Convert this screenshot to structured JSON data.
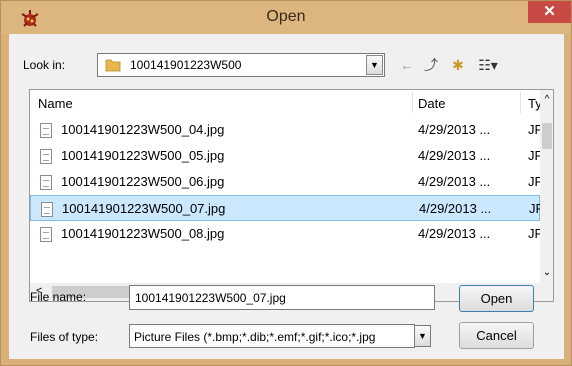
{
  "window": {
    "title": "Open",
    "close_glyph": "✕"
  },
  "look_in": {
    "label": "Look in:",
    "folder": "100141901223W500"
  },
  "toolbar": {
    "back_glyph": "←",
    "up_glyph": "⤴",
    "new_folder_glyph": "✱",
    "views_glyph": "☷▾"
  },
  "file_list": {
    "columns": {
      "name": "Name",
      "date": "Date",
      "type": "Ty"
    },
    "rows": [
      {
        "name": "100141901223W500_04.jpg",
        "date": "4/29/2013 ...",
        "type": "JP"
      },
      {
        "name": "100141901223W500_05.jpg",
        "date": "4/29/2013 ...",
        "type": "JP"
      },
      {
        "name": "100141901223W500_06.jpg",
        "date": "4/29/2013 ...",
        "type": "JP"
      },
      {
        "name": "100141901223W500_07.jpg",
        "date": "4/29/2013 ...",
        "type": "JP"
      },
      {
        "name": "100141901223W500_08.jpg",
        "date": "4/29/2013 ...",
        "type": "JP"
      }
    ],
    "selected_index": 3
  },
  "file_name": {
    "label": "File name:",
    "value": "100141901223W500_07.jpg"
  },
  "file_type": {
    "label": "Files of type:",
    "value": "Picture Files (*.bmp;*.dib;*.emf;*.gif;*.ico;*.jpg"
  },
  "buttons": {
    "open": "Open",
    "cancel": "Cancel"
  },
  "colors": {
    "title_bar": "#dcb57f",
    "close_button": "#c94a45",
    "selection": "#cce8ff"
  }
}
